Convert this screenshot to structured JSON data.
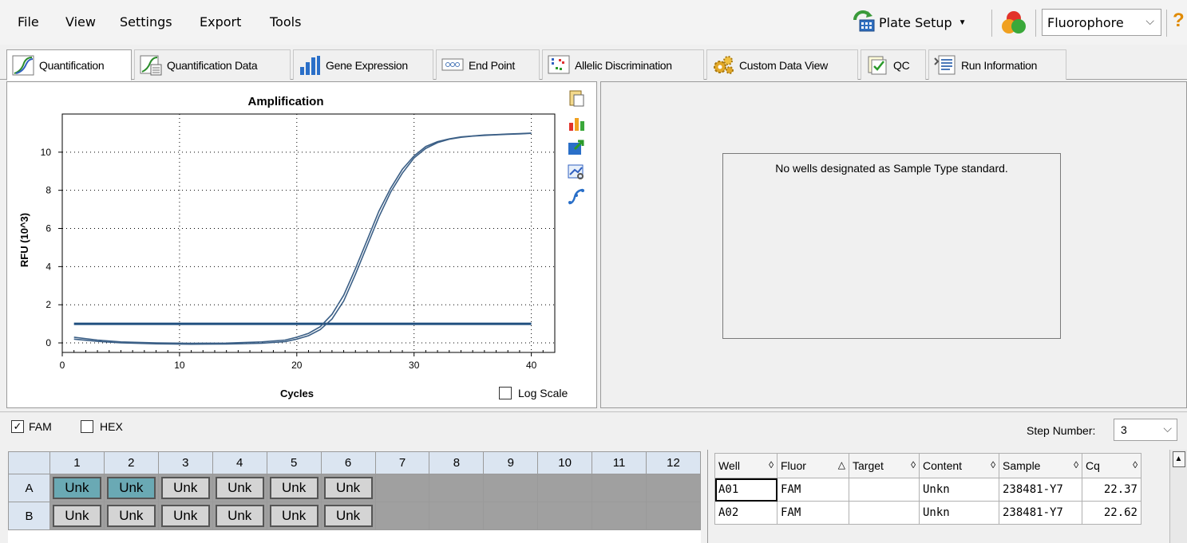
{
  "menu": [
    "File",
    "View",
    "Settings",
    "Export",
    "Tools"
  ],
  "toolbar": {
    "plate_setup_label": "Plate Setup",
    "dropdown_value": "Fluorophore",
    "help_glyph": "?"
  },
  "tabs": [
    {
      "label": "Quantification",
      "icon": "amplification-icon"
    },
    {
      "label": "Quantification Data",
      "icon": "quantification-data-icon"
    },
    {
      "label": "Gene Expression",
      "icon": "bar-chart-icon"
    },
    {
      "label": "End Point",
      "icon": "end-point-icon"
    },
    {
      "label": "Allelic Discrimination",
      "icon": "allelic-icon"
    },
    {
      "label": "Custom Data View",
      "icon": "gear-cluster-icon"
    },
    {
      "label": "QC",
      "icon": "qc-icon"
    },
    {
      "label": "Run Information",
      "icon": "run-info-icon"
    }
  ],
  "chart_data": {
    "type": "line",
    "title": "Amplification",
    "xlabel": "Cycles",
    "ylabel": "RFU (10^3)",
    "xlim": [
      0,
      42
    ],
    "ylim": [
      -0.5,
      12
    ],
    "xticks": [
      0,
      10,
      20,
      30,
      40
    ],
    "yticks": [
      0,
      2,
      4,
      6,
      8,
      10
    ],
    "grid": true,
    "threshold": 1.0,
    "series": [
      {
        "x": [
          1,
          3,
          5,
          8,
          11,
          14,
          17,
          19,
          20,
          21,
          22,
          23,
          24,
          25,
          26,
          27,
          28,
          29,
          30,
          31,
          32,
          33,
          34,
          35,
          36,
          37,
          38,
          39,
          40
        ],
        "y": [
          0.3,
          0.15,
          0.05,
          0.0,
          -0.02,
          -0.01,
          0.05,
          0.15,
          0.3,
          0.5,
          0.85,
          1.5,
          2.5,
          3.9,
          5.4,
          6.9,
          8.1,
          9.1,
          9.8,
          10.3,
          10.55,
          10.7,
          10.8,
          10.85,
          10.9,
          10.92,
          10.95,
          10.97,
          11.0
        ]
      },
      {
        "x": [
          1,
          3,
          5,
          8,
          11,
          14,
          17,
          19,
          20,
          21,
          22,
          23,
          24,
          25,
          26,
          27,
          28,
          29,
          30,
          31,
          32,
          33,
          34,
          35,
          36,
          37,
          38,
          39,
          40
        ],
        "y": [
          0.2,
          0.08,
          0.0,
          -0.05,
          -0.07,
          -0.06,
          -0.02,
          0.07,
          0.2,
          0.38,
          0.7,
          1.25,
          2.2,
          3.6,
          5.1,
          6.6,
          7.9,
          8.9,
          9.7,
          10.2,
          10.5,
          10.68,
          10.78,
          10.84,
          10.88,
          10.91,
          10.94,
          10.96,
          10.99
        ]
      }
    ],
    "line_color": "#3b5f86",
    "threshold_color": "#1f4f7f"
  },
  "chart_tools": [
    "copy-icon",
    "chart-options-icon",
    "export-icon",
    "zoom-icon",
    "curve-fit-icon"
  ],
  "log_scale_label": "Log Scale",
  "right_message": "No wells designated as Sample Type standard.",
  "fluors": [
    {
      "label": "FAM",
      "checked": true
    },
    {
      "label": "HEX",
      "checked": false
    }
  ],
  "step_number": {
    "label": "Step Number:",
    "value": "3"
  },
  "plate": {
    "columns": [
      "1",
      "2",
      "3",
      "4",
      "5",
      "6",
      "7",
      "8",
      "9",
      "10",
      "11",
      "12"
    ],
    "rows": [
      {
        "label": "A",
        "wells": [
          "Unk",
          "Unk",
          "Unk",
          "Unk",
          "Unk",
          "Unk"
        ],
        "selected": [
          0,
          1
        ]
      },
      {
        "label": "B",
        "wells": [
          "Unk",
          "Unk",
          "Unk",
          "Unk",
          "Unk",
          "Unk"
        ],
        "selected": []
      }
    ],
    "selected_color": "#6aa9b4"
  },
  "data_table": {
    "headers": [
      {
        "label": "Well",
        "sort": "◊"
      },
      {
        "label": "Fluor",
        "sort": "△"
      },
      {
        "label": "Target",
        "sort": "◊"
      },
      {
        "label": "Content",
        "sort": "◊"
      },
      {
        "label": "Sample",
        "sort": "◊"
      },
      {
        "label": "Cq",
        "sort": "◊"
      }
    ],
    "rows": [
      [
        "A01",
        "FAM",
        "",
        "Unkn",
        "238481-Y7",
        "22.37"
      ],
      [
        "A02",
        "FAM",
        "",
        "Unkn",
        "238481-Y7",
        "22.62"
      ]
    ]
  }
}
